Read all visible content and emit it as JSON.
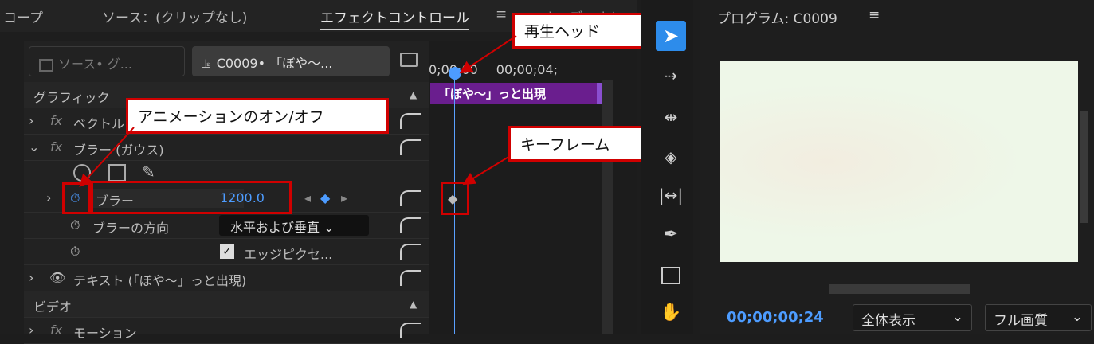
{
  "tabs": {
    "scope": "コープ",
    "source": "ソース：(クリップなし)",
    "effect_controls": "エフェクトコントロール",
    "menu_icon": "≡",
    "extra": "オーディオト"
  },
  "source_selector": {
    "label": "ソース• グ..."
  },
  "clip_selector": {
    "label": "C0009• 「ぼや～..."
  },
  "timeline": {
    "start_time": "0;00;00",
    "end_time": "00;00;04;",
    "clip_name": "「ぼや～」っと出現"
  },
  "rows": {
    "graphic_header": "グラフィック",
    "vector": "ベクトル",
    "blur_gauss": "ブラー (ガウス)",
    "blur_param": "ブラー",
    "blur_value": "1200.0",
    "blur_direction": "ブラーの方向",
    "blur_direction_value": "水平および垂直",
    "edge_pixel": "エッジピクセ...",
    "text_layer": "テキスト (「ぼや～」っと出現)",
    "video_header": "ビデオ",
    "motion": "モーション"
  },
  "callouts": {
    "playhead": "再生ヘッド",
    "animation_toggle": "アニメーションのオン/オフ",
    "keyframe": "キーフレーム"
  },
  "program": {
    "title": "プログラム: C0009",
    "menu_icon": "≡",
    "timecode": "00;00;00;24",
    "zoom": "全体表示",
    "quality": "フル画質"
  },
  "tools": [
    "selection-icon",
    "track-select-icon",
    "ripple-edit-icon",
    "razor-icon",
    "slip-icon",
    "pen-icon",
    "rectangle-icon",
    "hand-icon"
  ],
  "colors": {
    "accent": "#2d8ceb",
    "clip": "#6a1e8e",
    "callout_border": "#d00000",
    "value_blue": "#4d9cff"
  }
}
